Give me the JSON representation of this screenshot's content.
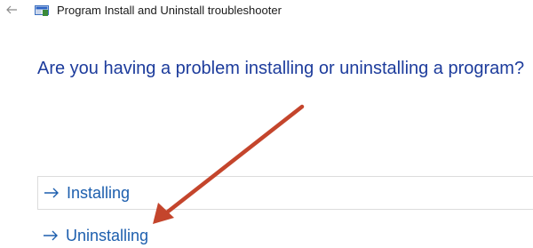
{
  "window": {
    "back_icon": "back-arrow-icon",
    "app_icon": "program-troubleshooter-icon",
    "title": "Program Install and Uninstall troubleshooter"
  },
  "main": {
    "heading": "Are you having a problem installing or uninstalling a program?",
    "options": [
      {
        "label": "Installing",
        "icon": "arrow-right-icon"
      },
      {
        "label": "Uninstalling",
        "icon": "arrow-right-icon"
      }
    ]
  },
  "colors": {
    "heading": "#1d3c9c",
    "link": "#1d5fae",
    "annotation_arrow": "#c4452c",
    "border": "#dcdcdc"
  }
}
